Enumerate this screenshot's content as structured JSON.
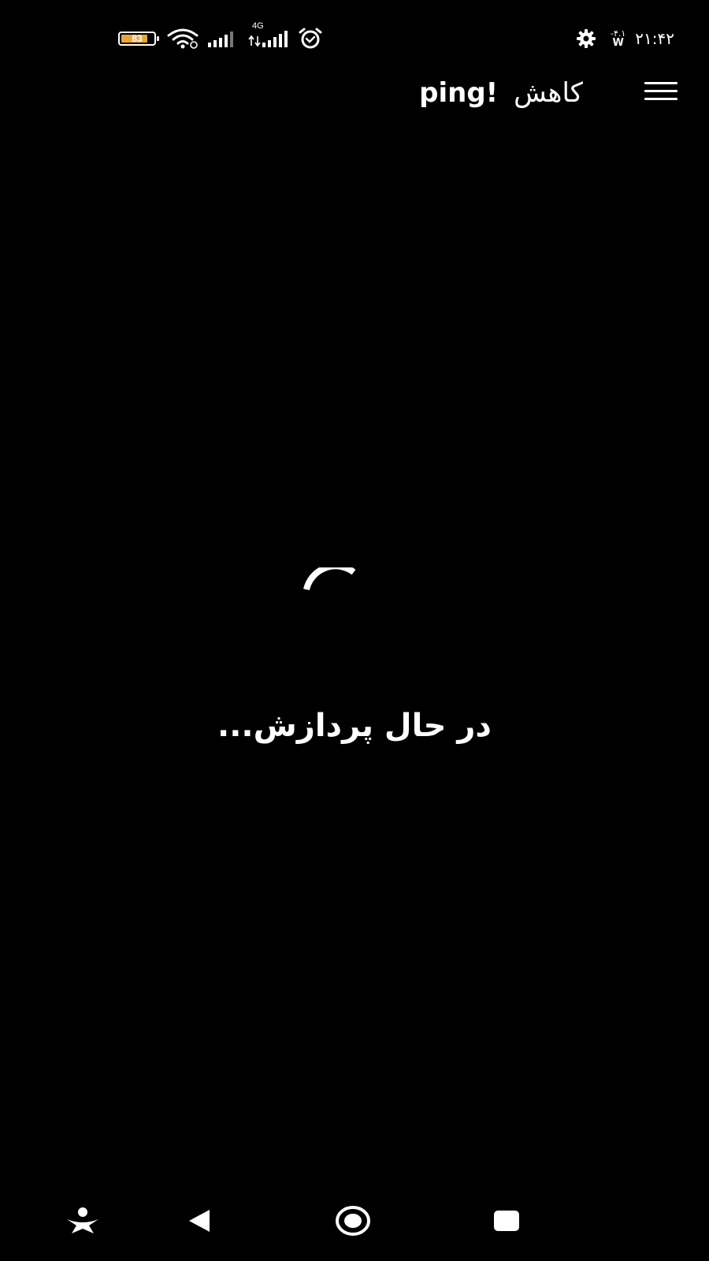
{
  "status_bar": {
    "battery_level": "83",
    "network_type": "4G",
    "clock": "۲۱:۴۲",
    "temperature": "-۴.۱",
    "weather_label": "W",
    "icons": [
      "battery-icon",
      "wifi-icon",
      "signal-icon",
      "signal-4g-icon",
      "alarm-icon",
      "gear-icon"
    ],
    "battery_color": "#e7a737"
  },
  "header": {
    "title_persian": "کاهش",
    "title_latin": "ping!",
    "menu_icon": "hamburger-menu-icon"
  },
  "main": {
    "processing_text": "در حال پردازش...",
    "spinner_icon": "loading-spinner-icon"
  },
  "nav_bar": {
    "icons": [
      "accessibility-icon",
      "back-icon",
      "home-icon",
      "recents-icon"
    ]
  }
}
